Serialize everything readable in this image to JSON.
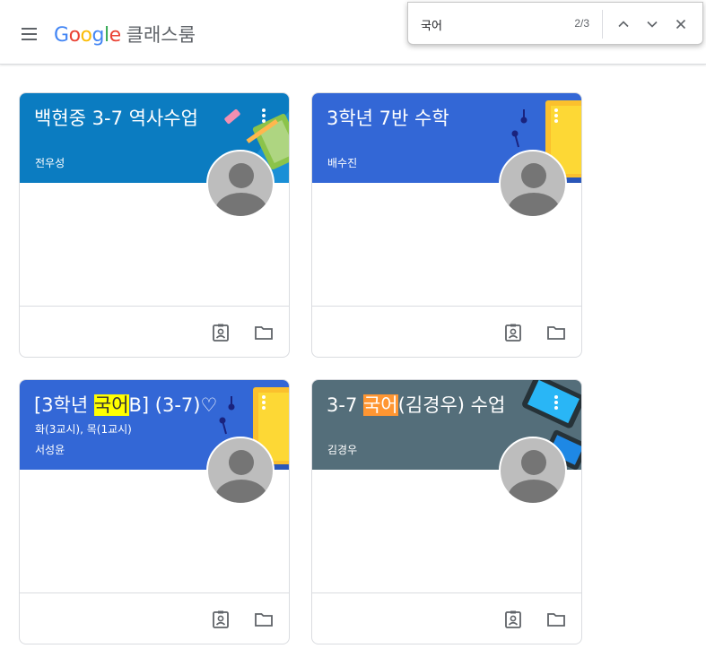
{
  "header": {
    "logo_letters": [
      {
        "ch": "G",
        "color": "#4285F4"
      },
      {
        "ch": "o",
        "color": "#EA4335"
      },
      {
        "ch": "o",
        "color": "#FBBC05"
      },
      {
        "ch": "g",
        "color": "#4285F4"
      },
      {
        "ch": "l",
        "color": "#34A853"
      },
      {
        "ch": "e",
        "color": "#EA4335"
      }
    ],
    "app_name": "클래스룸",
    "menu_icon": "hamburger-menu-icon"
  },
  "findbar": {
    "query": "국어",
    "count": "2/3",
    "prev_icon": "chevron-up-icon",
    "next_icon": "chevron-down-icon",
    "close_icon": "close-icon"
  },
  "cards": [
    {
      "title": "백현중 3-7 역사수업",
      "title_parts": [],
      "sub1": "",
      "teacher": "전우성",
      "color": "#0b7cc1"
    },
    {
      "title": "3학년 7반 수학",
      "title_parts": [],
      "sub1": "",
      "teacher": "배수진",
      "color": "#3367d6"
    },
    {
      "title": "",
      "title_parts": [
        "[3학년 ",
        "국어",
        "B] (3-7)♡"
      ],
      "sub1": "화(3교시), 목(1교시)",
      "teacher": "서성윤",
      "color": "#3367d6"
    },
    {
      "title": "",
      "title_parts": [
        "3-7 ",
        "국어",
        "(김경우) 수업"
      ],
      "sub1": "",
      "teacher": "김경우",
      "color": "#546e7a"
    }
  ],
  "card_icons": {
    "assignments": "assignment-ind-icon",
    "folder": "folder-icon"
  }
}
